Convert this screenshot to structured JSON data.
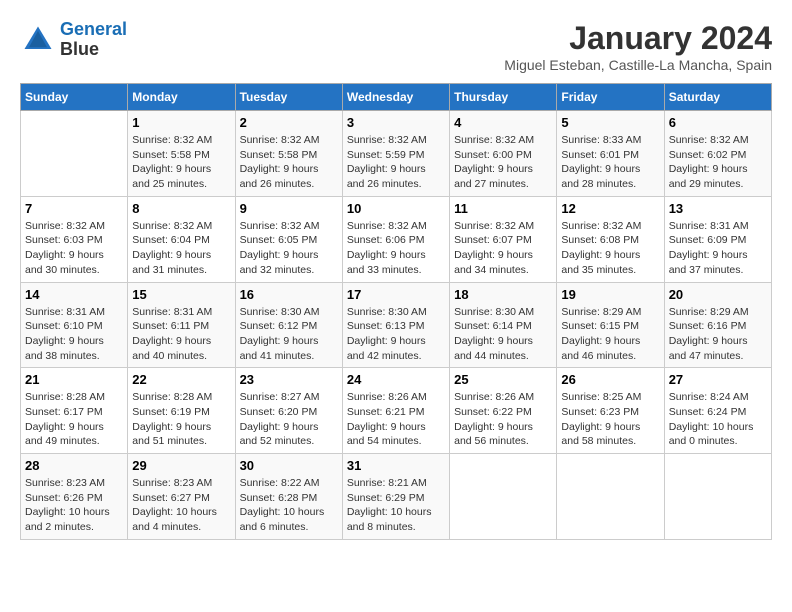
{
  "header": {
    "logo_line1": "General",
    "logo_line2": "Blue",
    "month": "January 2024",
    "location": "Miguel Esteban, Castille-La Mancha, Spain"
  },
  "weekdays": [
    "Sunday",
    "Monday",
    "Tuesday",
    "Wednesday",
    "Thursday",
    "Friday",
    "Saturday"
  ],
  "weeks": [
    [
      {
        "day": null
      },
      {
        "day": "1",
        "sunrise": "Sunrise: 8:32 AM",
        "sunset": "Sunset: 5:58 PM",
        "daylight": "Daylight: 9 hours and 25 minutes."
      },
      {
        "day": "2",
        "sunrise": "Sunrise: 8:32 AM",
        "sunset": "Sunset: 5:58 PM",
        "daylight": "Daylight: 9 hours and 26 minutes."
      },
      {
        "day": "3",
        "sunrise": "Sunrise: 8:32 AM",
        "sunset": "Sunset: 5:59 PM",
        "daylight": "Daylight: 9 hours and 26 minutes."
      },
      {
        "day": "4",
        "sunrise": "Sunrise: 8:32 AM",
        "sunset": "Sunset: 6:00 PM",
        "daylight": "Daylight: 9 hours and 27 minutes."
      },
      {
        "day": "5",
        "sunrise": "Sunrise: 8:33 AM",
        "sunset": "Sunset: 6:01 PM",
        "daylight": "Daylight: 9 hours and 28 minutes."
      },
      {
        "day": "6",
        "sunrise": "Sunrise: 8:32 AM",
        "sunset": "Sunset: 6:02 PM",
        "daylight": "Daylight: 9 hours and 29 minutes."
      }
    ],
    [
      {
        "day": "7",
        "sunrise": "Sunrise: 8:32 AM",
        "sunset": "Sunset: 6:03 PM",
        "daylight": "Daylight: 9 hours and 30 minutes."
      },
      {
        "day": "8",
        "sunrise": "Sunrise: 8:32 AM",
        "sunset": "Sunset: 6:04 PM",
        "daylight": "Daylight: 9 hours and 31 minutes."
      },
      {
        "day": "9",
        "sunrise": "Sunrise: 8:32 AM",
        "sunset": "Sunset: 6:05 PM",
        "daylight": "Daylight: 9 hours and 32 minutes."
      },
      {
        "day": "10",
        "sunrise": "Sunrise: 8:32 AM",
        "sunset": "Sunset: 6:06 PM",
        "daylight": "Daylight: 9 hours and 33 minutes."
      },
      {
        "day": "11",
        "sunrise": "Sunrise: 8:32 AM",
        "sunset": "Sunset: 6:07 PM",
        "daylight": "Daylight: 9 hours and 34 minutes."
      },
      {
        "day": "12",
        "sunrise": "Sunrise: 8:32 AM",
        "sunset": "Sunset: 6:08 PM",
        "daylight": "Daylight: 9 hours and 35 minutes."
      },
      {
        "day": "13",
        "sunrise": "Sunrise: 8:31 AM",
        "sunset": "Sunset: 6:09 PM",
        "daylight": "Daylight: 9 hours and 37 minutes."
      }
    ],
    [
      {
        "day": "14",
        "sunrise": "Sunrise: 8:31 AM",
        "sunset": "Sunset: 6:10 PM",
        "daylight": "Daylight: 9 hours and 38 minutes."
      },
      {
        "day": "15",
        "sunrise": "Sunrise: 8:31 AM",
        "sunset": "Sunset: 6:11 PM",
        "daylight": "Daylight: 9 hours and 40 minutes."
      },
      {
        "day": "16",
        "sunrise": "Sunrise: 8:30 AM",
        "sunset": "Sunset: 6:12 PM",
        "daylight": "Daylight: 9 hours and 41 minutes."
      },
      {
        "day": "17",
        "sunrise": "Sunrise: 8:30 AM",
        "sunset": "Sunset: 6:13 PM",
        "daylight": "Daylight: 9 hours and 42 minutes."
      },
      {
        "day": "18",
        "sunrise": "Sunrise: 8:30 AM",
        "sunset": "Sunset: 6:14 PM",
        "daylight": "Daylight: 9 hours and 44 minutes."
      },
      {
        "day": "19",
        "sunrise": "Sunrise: 8:29 AM",
        "sunset": "Sunset: 6:15 PM",
        "daylight": "Daylight: 9 hours and 46 minutes."
      },
      {
        "day": "20",
        "sunrise": "Sunrise: 8:29 AM",
        "sunset": "Sunset: 6:16 PM",
        "daylight": "Daylight: 9 hours and 47 minutes."
      }
    ],
    [
      {
        "day": "21",
        "sunrise": "Sunrise: 8:28 AM",
        "sunset": "Sunset: 6:17 PM",
        "daylight": "Daylight: 9 hours and 49 minutes."
      },
      {
        "day": "22",
        "sunrise": "Sunrise: 8:28 AM",
        "sunset": "Sunset: 6:19 PM",
        "daylight": "Daylight: 9 hours and 51 minutes."
      },
      {
        "day": "23",
        "sunrise": "Sunrise: 8:27 AM",
        "sunset": "Sunset: 6:20 PM",
        "daylight": "Daylight: 9 hours and 52 minutes."
      },
      {
        "day": "24",
        "sunrise": "Sunrise: 8:26 AM",
        "sunset": "Sunset: 6:21 PM",
        "daylight": "Daylight: 9 hours and 54 minutes."
      },
      {
        "day": "25",
        "sunrise": "Sunrise: 8:26 AM",
        "sunset": "Sunset: 6:22 PM",
        "daylight": "Daylight: 9 hours and 56 minutes."
      },
      {
        "day": "26",
        "sunrise": "Sunrise: 8:25 AM",
        "sunset": "Sunset: 6:23 PM",
        "daylight": "Daylight: 9 hours and 58 minutes."
      },
      {
        "day": "27",
        "sunrise": "Sunrise: 8:24 AM",
        "sunset": "Sunset: 6:24 PM",
        "daylight": "Daylight: 10 hours and 0 minutes."
      }
    ],
    [
      {
        "day": "28",
        "sunrise": "Sunrise: 8:23 AM",
        "sunset": "Sunset: 6:26 PM",
        "daylight": "Daylight: 10 hours and 2 minutes."
      },
      {
        "day": "29",
        "sunrise": "Sunrise: 8:23 AM",
        "sunset": "Sunset: 6:27 PM",
        "daylight": "Daylight: 10 hours and 4 minutes."
      },
      {
        "day": "30",
        "sunrise": "Sunrise: 8:22 AM",
        "sunset": "Sunset: 6:28 PM",
        "daylight": "Daylight: 10 hours and 6 minutes."
      },
      {
        "day": "31",
        "sunrise": "Sunrise: 8:21 AM",
        "sunset": "Sunset: 6:29 PM",
        "daylight": "Daylight: 10 hours and 8 minutes."
      },
      {
        "day": null
      },
      {
        "day": null
      },
      {
        "day": null
      }
    ]
  ]
}
